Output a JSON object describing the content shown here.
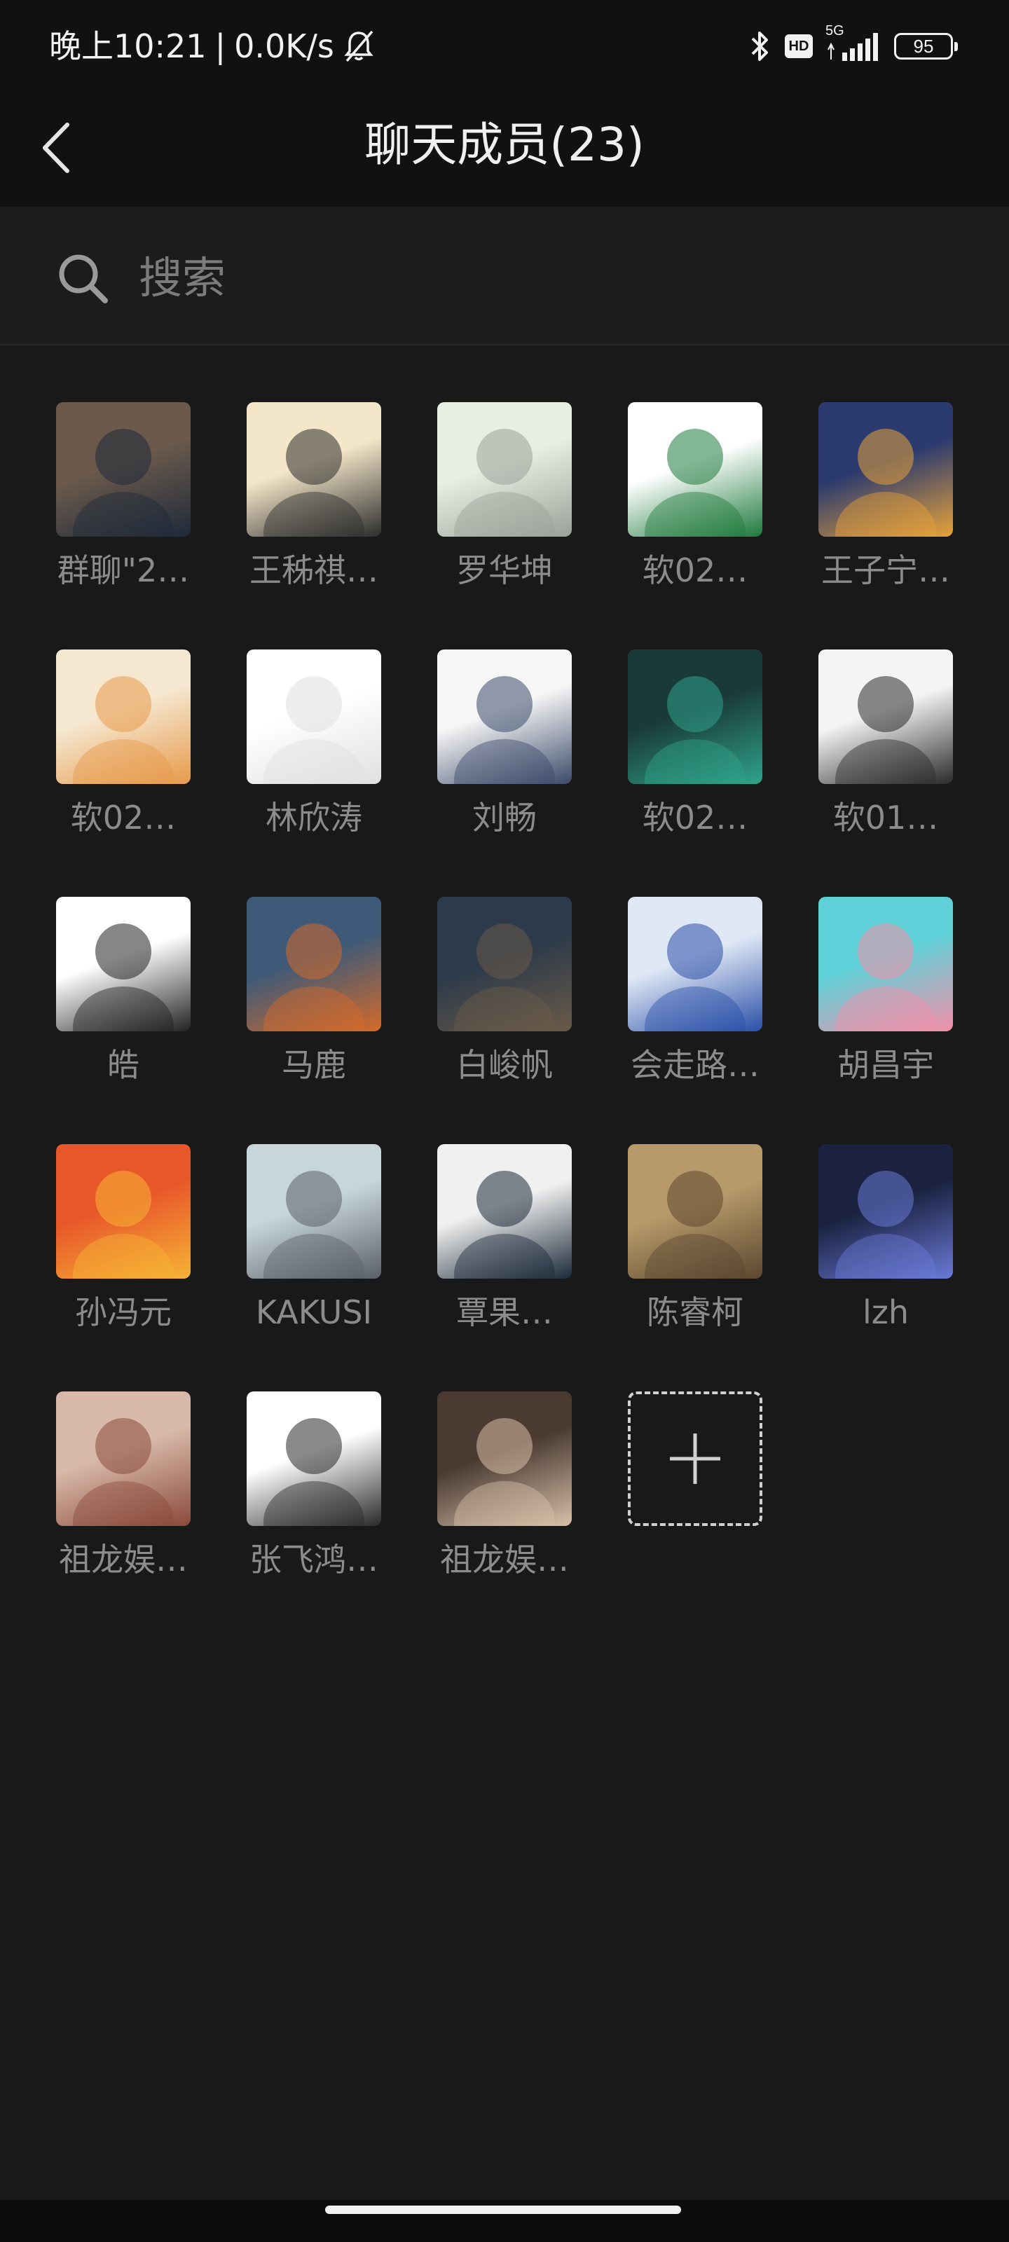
{
  "status_bar": {
    "time": "晚上10:21",
    "separator": "|",
    "network_speed": "0.0K/s",
    "hd_label": "HD",
    "network_type": "5G",
    "battery_level": "95"
  },
  "header": {
    "title": "聊天成员(23)"
  },
  "search": {
    "placeholder": "搜索"
  },
  "members": [
    {
      "name": "群聊\"2…",
      "avatar": "photo-man-suit",
      "colors": [
        "#6b5a4c",
        "#1f2a3a"
      ]
    },
    {
      "name": "王秭祺…",
      "avatar": "bunny-cartoon",
      "colors": [
        "#f4e6c8",
        "#2d2d2d"
      ]
    },
    {
      "name": "罗华坤",
      "avatar": "anime-boy-desk",
      "colors": [
        "#e8efe0",
        "#9aa19a"
      ]
    },
    {
      "name": "软02…",
      "avatar": "green-logo",
      "colors": [
        "#ffffff",
        "#1e7a3c"
      ]
    },
    {
      "name": "王子宁…",
      "avatar": "sunset-sea",
      "colors": [
        "#2a3a6e",
        "#e8a23a"
      ]
    },
    {
      "name": "软02…",
      "avatar": "shiba-dog",
      "colors": [
        "#f5e7d0",
        "#e79a4a"
      ]
    },
    {
      "name": "林欣涛",
      "avatar": "white-cat",
      "colors": [
        "#ffffff",
        "#e0e0e0"
      ]
    },
    {
      "name": "刘畅",
      "avatar": "anime-girl-chibi",
      "colors": [
        "#f6f6f6",
        "#3b4a6a"
      ]
    },
    {
      "name": "软02…",
      "avatar": "anime-bunny-hood",
      "colors": [
        "#1a3a3a",
        "#2fa38a"
      ]
    },
    {
      "name": "软01…",
      "avatar": "egg-sketch",
      "colors": [
        "#f4f4f4",
        "#2a2a2a"
      ]
    },
    {
      "name": "皓",
      "avatar": "line-drawing-boy",
      "colors": [
        "#ffffff",
        "#222222"
      ]
    },
    {
      "name": "马鹿",
      "avatar": "orange-fox",
      "colors": [
        "#3e5a78",
        "#d46a2a"
      ]
    },
    {
      "name": "白峻帆",
      "avatar": "toy-figure",
      "colors": [
        "#2c3a4a",
        "#6a5a48"
      ]
    },
    {
      "name": "会走路…",
      "avatar": "anime-girl-blue-hair",
      "colors": [
        "#dfe8f5",
        "#2a4fa8"
      ]
    },
    {
      "name": "胡昌宇",
      "avatar": "patrick-star",
      "colors": [
        "#5fd0d8",
        "#f28fa8"
      ]
    },
    {
      "name": "孙冯元",
      "avatar": "comic-superman",
      "colors": [
        "#e8572a",
        "#f6b335"
      ]
    },
    {
      "name": "KAKUSI",
      "avatar": "grey-cat",
      "colors": [
        "#c8d6dc",
        "#5a6068"
      ]
    },
    {
      "name": "覃果…",
      "avatar": "anime-boy-sketch",
      "colors": [
        "#f0f0f0",
        "#1d2a3a"
      ]
    },
    {
      "name": "陈睿柯",
      "avatar": "cats-mirror",
      "colors": [
        "#b89a6a",
        "#5c4830"
      ]
    },
    {
      "name": "lzh",
      "avatar": "robot-mech",
      "colors": [
        "#1a2240",
        "#6a7ad8"
      ]
    },
    {
      "name": "祖龙娱…",
      "avatar": "photo-woman-smile",
      "colors": [
        "#d8b8a8",
        "#8a4a3a"
      ]
    },
    {
      "name": "张飞鸿…",
      "avatar": "chibi-boy-ghost",
      "colors": [
        "#ffffff",
        "#2a2a2a"
      ]
    },
    {
      "name": "祖龙娱…",
      "avatar": "photo-girl-cat",
      "colors": [
        "#4a3a32",
        "#d8c0a8"
      ]
    }
  ],
  "add_member": {
    "icon": "plus-icon"
  }
}
